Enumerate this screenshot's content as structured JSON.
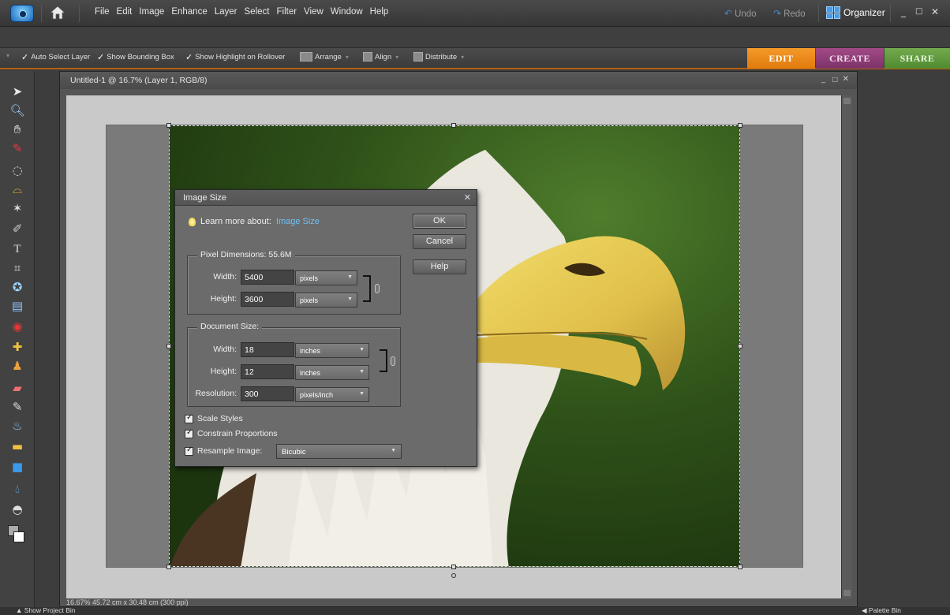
{
  "menubar": {
    "items": [
      "File",
      "Edit",
      "Image",
      "Enhance",
      "Layer",
      "Select",
      "Filter",
      "View",
      "Window",
      "Help"
    ],
    "undo_label": "Undo",
    "redo_label": "Redo",
    "organizer_label": "Organizer"
  },
  "options_bar": {
    "auto_select_label": "Auto Select Layer",
    "bounding_box_label": "Show Bounding Box",
    "highlight_label": "Show Highlight on Rollover",
    "arrange_label": "Arrange",
    "align_label": "Align",
    "distribute_label": "Distribute"
  },
  "mode_tabs": {
    "edit": "EDIT",
    "create": "CREATE",
    "share": "SHARE"
  },
  "document": {
    "title": "Untitled-1 @ 16.7% (Layer 1, RGB/8)",
    "status_text": "16.67%      45.72 cm x 30.48 cm (300 ppi)"
  },
  "dialog": {
    "title": "Image Size",
    "learn_prefix": "Learn more about:",
    "learn_link": "Image Size",
    "ok_label": "OK",
    "cancel_label": "Cancel",
    "help_label": "Help",
    "pixel_dimensions": {
      "legend": "Pixel Dimensions:  55.6M",
      "width_label": "Width:",
      "width_value": "5400",
      "width_unit": "pixels",
      "height_label": "Height:",
      "height_value": "3600",
      "height_unit": "pixels"
    },
    "document_size": {
      "legend": "Document Size:",
      "width_label": "Width:",
      "width_value": "18",
      "width_unit": "inches",
      "height_label": "Height:",
      "height_value": "12",
      "height_unit": "inches",
      "resolution_label": "Resolution:",
      "resolution_value": "300",
      "resolution_unit": "pixels/inch"
    },
    "scale_styles_label": "Scale Styles",
    "constrain_label": "Constrain Proportions",
    "resample_label": "Resample Image:",
    "resample_value": "Bicubic"
  },
  "bottom_bar": {
    "project_bin_label": "Show Project Bin",
    "palette_bin_label": "Palette Bin"
  },
  "colors": {
    "edit_tab": "#e88414",
    "create_tab": "#8e3c77",
    "share_tab": "#5f9a3c",
    "link_blue": "#6ec0f5"
  }
}
